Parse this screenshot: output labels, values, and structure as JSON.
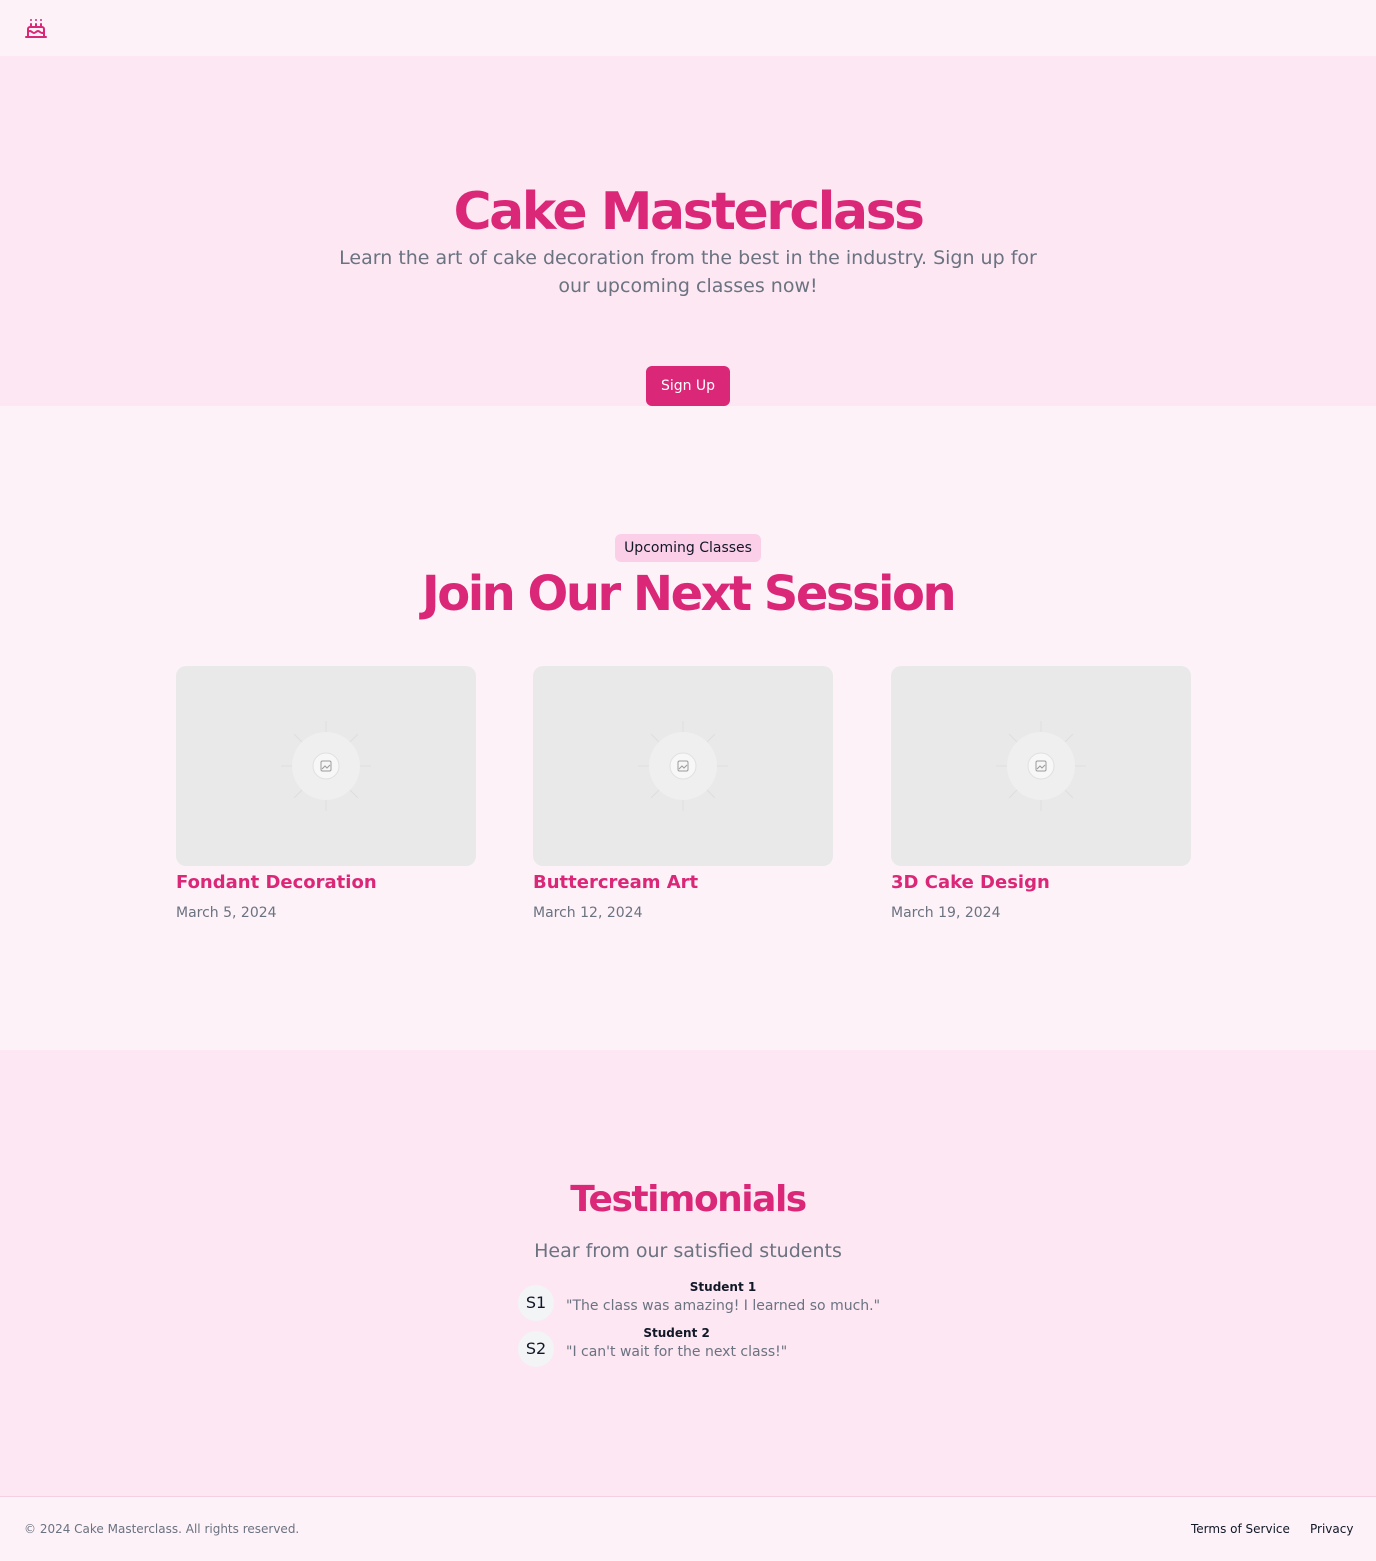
{
  "header": {
    "logo_icon": "cake-icon"
  },
  "hero": {
    "title": "Cake Masterclass",
    "subtitle": "Learn the art of cake decoration from the best in the industry. Sign up for our upcoming classes now!",
    "cta_label": "Sign Up"
  },
  "classes": {
    "badge": "Upcoming Classes",
    "title": "Join Our Next Session",
    "items": [
      {
        "title": "Fondant Decoration",
        "date": "March 5, 2024",
        "image_icon": "image-placeholder-icon"
      },
      {
        "title": "Buttercream Art",
        "date": "March 12, 2024",
        "image_icon": "image-placeholder-icon"
      },
      {
        "title": "3D Cake Design",
        "date": "March 19, 2024",
        "image_icon": "image-placeholder-icon"
      }
    ]
  },
  "testimonials": {
    "title": "Testimonials",
    "subtitle": "Hear from our satisfied students",
    "items": [
      {
        "avatar": "S1",
        "name": "Student 1",
        "quote": "\"The class was amazing! I learned so much.\""
      },
      {
        "avatar": "S2",
        "name": "Student 2",
        "quote": "\"I can't wait for the next class!\""
      }
    ]
  },
  "footer": {
    "copyright": "© 2024 Cake Masterclass. All rights reserved.",
    "links": [
      "Terms of Service",
      "Privacy"
    ]
  },
  "colors": {
    "accent": "#db2777",
    "hero_bg": "#fce7f3",
    "page_bg": "#fdf2f8"
  }
}
